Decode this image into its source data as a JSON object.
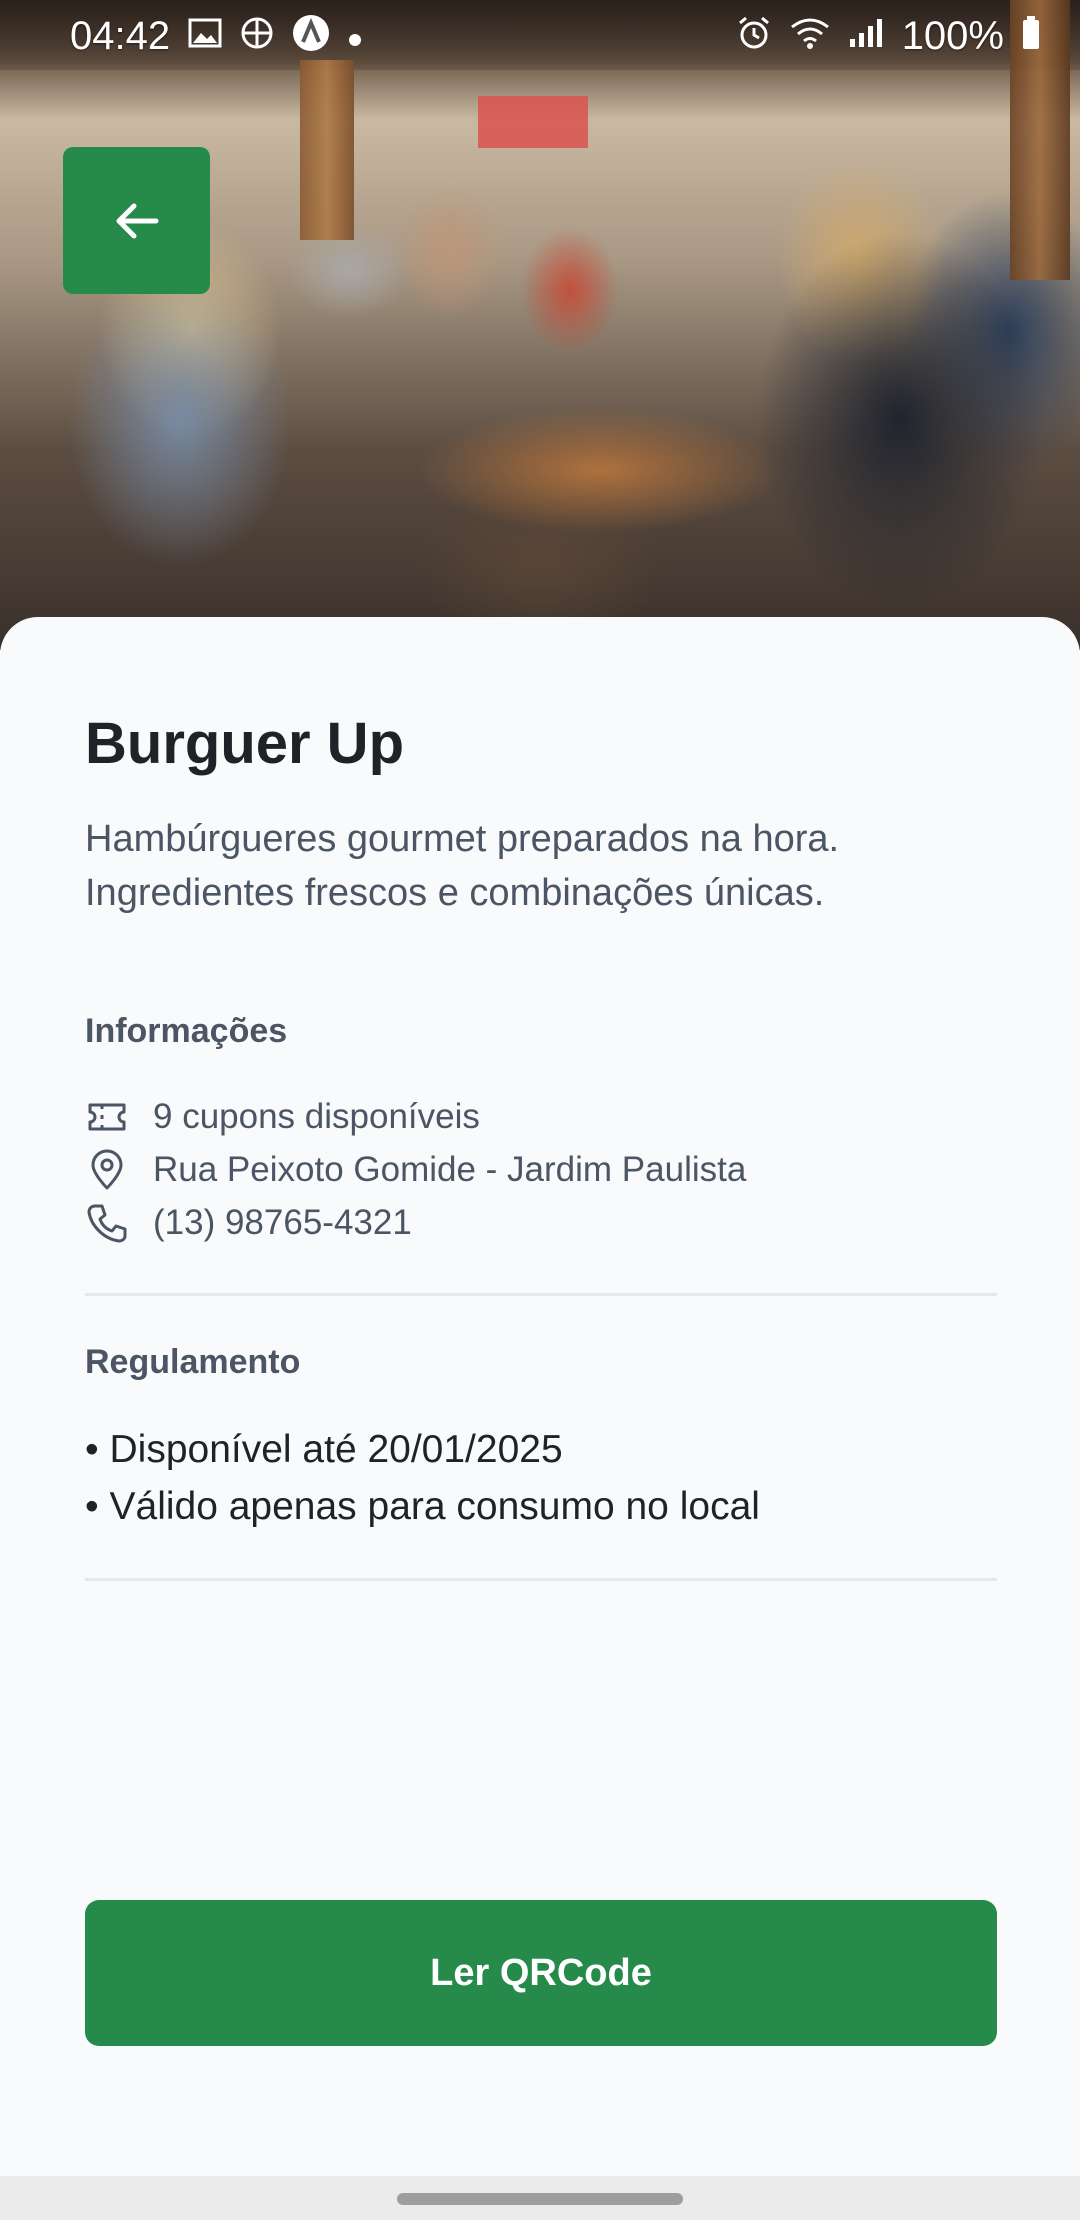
{
  "status_bar": {
    "time": "04:42",
    "battery": "100%",
    "left_icons": [
      "image-icon",
      "basketball-icon",
      "app-icon",
      "dot-icon"
    ],
    "right_icons": [
      "alarm-icon",
      "wifi-icon",
      "signal-icon",
      "battery-icon"
    ]
  },
  "store": {
    "name": "Burguer Up",
    "description": "Hambúrgueres gourmet preparados na hora. Ingredientes frescos e combinações únicas."
  },
  "info_section": {
    "heading": "Informações",
    "items": [
      {
        "icon": "ticket-icon",
        "text": "9 cupons disponíveis"
      },
      {
        "icon": "map-pin-icon",
        "text": "Rua Peixoto Gomide - Jardim Paulista"
      },
      {
        "icon": "phone-icon",
        "text": "(13) 98765-4321"
      }
    ]
  },
  "rules_section": {
    "heading": "Regulamento",
    "items": [
      "• Disponível até 20/01/2025",
      "• Válido apenas para consumo no local"
    ]
  },
  "actions": {
    "read_qrcode_label": "Ler QRCode"
  },
  "colors": {
    "primary": "#268a4a",
    "text_dark": "#1f2328",
    "text_muted": "#4b5563",
    "background": "#f8fafc"
  }
}
